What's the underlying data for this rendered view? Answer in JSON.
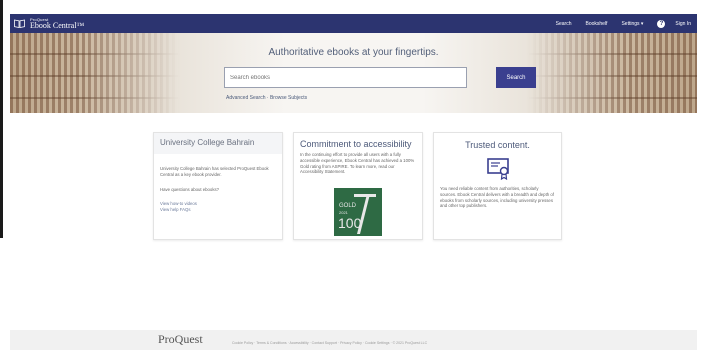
{
  "header": {
    "brand_small": "ProQuest",
    "brand_name": "Ebook Central™",
    "nav": {
      "search": "Search",
      "bookshelf": "Bookshelf",
      "settings": "Settings ▾",
      "help": "?",
      "signin": "Sign In"
    }
  },
  "hero": {
    "title": "Authoritative ebooks at your fingertips.",
    "search_placeholder": "Search ebooks",
    "search_button": "Search",
    "advanced_search": "Advanced Search",
    "separator": "·",
    "browse_subjects": "Browse Subjects"
  },
  "cards": {
    "institution": {
      "title": "University College Bahrain",
      "intro": "University College Bahrain has selected ProQuest Ebook Central as a key ebook provider.",
      "question": "Have questions about ebooks?",
      "link1": "View how-to videos",
      "link2": "View help FAQs"
    },
    "accessibility": {
      "title": "Commitment to accessibility",
      "text": "In the continuing effort to provide all users with a fully accessible experience, Ebook Central has achieved a 100% Gold rating from ASPIRE. To learn more, read our Accessibility Statement.",
      "badge_gold": "GOLD",
      "badge_year": "2021",
      "badge_100": "100"
    },
    "trusted": {
      "title": "Trusted content.",
      "text": "You need reliable content from authorities, scholarly sources. Ebook Central delivers with a breadth and depth of ebooks from scholarly sources, including university presses and other top publishers."
    }
  },
  "footer": {
    "logo": "ProQuest",
    "links": "Cookie Policy · Terms & Conditions · Accessibility · Contact Support · Privacy Policy · Cookie Settings · © 2021 ProQuest LLC"
  },
  "colors": {
    "nav_bg": "#2c3470",
    "search_button": "#3a3f8f",
    "badge_green": "#2e6a44"
  }
}
